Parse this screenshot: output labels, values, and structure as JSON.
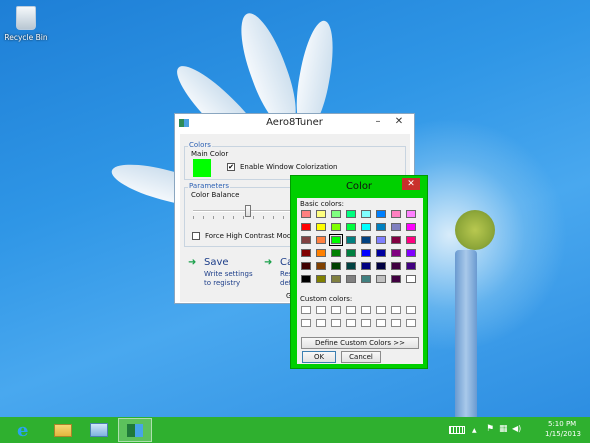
{
  "desktop": {
    "icons": [
      {
        "label": "Recycle Bin",
        "icon": "recycle-bin-icon"
      }
    ]
  },
  "aero_window": {
    "title": "Aero8Tuner",
    "minimize_glyph": "–",
    "close_glyph": "✕",
    "colors_group": {
      "title": "Colors",
      "main_color_label": "Main Color",
      "main_color_value": "#00ff00",
      "enable_colorization_label": "Enable Window Colorization",
      "enable_colorization_checked": true
    },
    "parameters_group": {
      "title": "Parameters",
      "color_balance_label": "Color Balance",
      "color_balance_fraction": 0.52,
      "force_high_contrast_label": "Force High Contrast Mode (you w",
      "force_high_contrast_checked": false
    },
    "actions": [
      {
        "title": "Save",
        "desc_line1": "Write settings",
        "desc_line2": "to registry"
      },
      {
        "title": "Canc",
        "desc_line1": "Resto",
        "desc_line2": "defau"
      }
    ],
    "footer_fragment": "G"
  },
  "color_dialog": {
    "title": "Color",
    "close_glyph": "✕",
    "basic_colors_label": "Basic colors:",
    "basic_colors": [
      [
        "#ff8080",
        "#ffff80",
        "#80ff80",
        "#00ff80",
        "#80ffff",
        "#0080ff",
        "#ff80c0",
        "#ff80ff"
      ],
      [
        "#ff0000",
        "#ffff00",
        "#80ff00",
        "#00ff40",
        "#00ffff",
        "#0080c0",
        "#8080c0",
        "#ff00ff"
      ],
      [
        "#804040",
        "#ff8040",
        "#00ff00",
        "#008080",
        "#004080",
        "#8080ff",
        "#800040",
        "#ff0080"
      ],
      [
        "#800000",
        "#ff8000",
        "#008000",
        "#008040",
        "#0000ff",
        "#0000a0",
        "#800080",
        "#8000ff"
      ],
      [
        "#400000",
        "#804000",
        "#004000",
        "#004040",
        "#000080",
        "#000040",
        "#400040",
        "#400080"
      ],
      [
        "#000000",
        "#808000",
        "#808040",
        "#808080",
        "#408080",
        "#c0c0c0",
        "#400040",
        "#ffffff"
      ]
    ],
    "selected_basic": "#00ff00",
    "custom_colors_label": "Custom colors:",
    "custom_colors": [
      [
        "#ffffff",
        "#ffffff",
        "#ffffff",
        "#ffffff",
        "#ffffff",
        "#ffffff",
        "#ffffff",
        "#ffffff"
      ],
      [
        "#ffffff",
        "#ffffff",
        "#ffffff",
        "#ffffff",
        "#ffffff",
        "#ffffff",
        "#ffffff",
        "#ffffff"
      ]
    ],
    "define_custom_label": "Define Custom Colors >>",
    "ok_label": "OK",
    "cancel_label": "Cancel"
  },
  "taskbar": {
    "color": "#2fb02f",
    "buttons": [
      {
        "name": "internet-explorer-icon"
      },
      {
        "name": "file-explorer-icon"
      },
      {
        "name": "control-panel-icon"
      },
      {
        "name": "aero8tuner-taskbar-icon",
        "active": true
      }
    ],
    "tray": {
      "keyboard_icon": "keyboard-icon",
      "chevron_glyph": "▲",
      "flag_glyph": "⚑",
      "network_glyph": "▦",
      "volume_glyph": "◀)",
      "time": "5:10 PM",
      "date": "1/15/2013"
    }
  }
}
